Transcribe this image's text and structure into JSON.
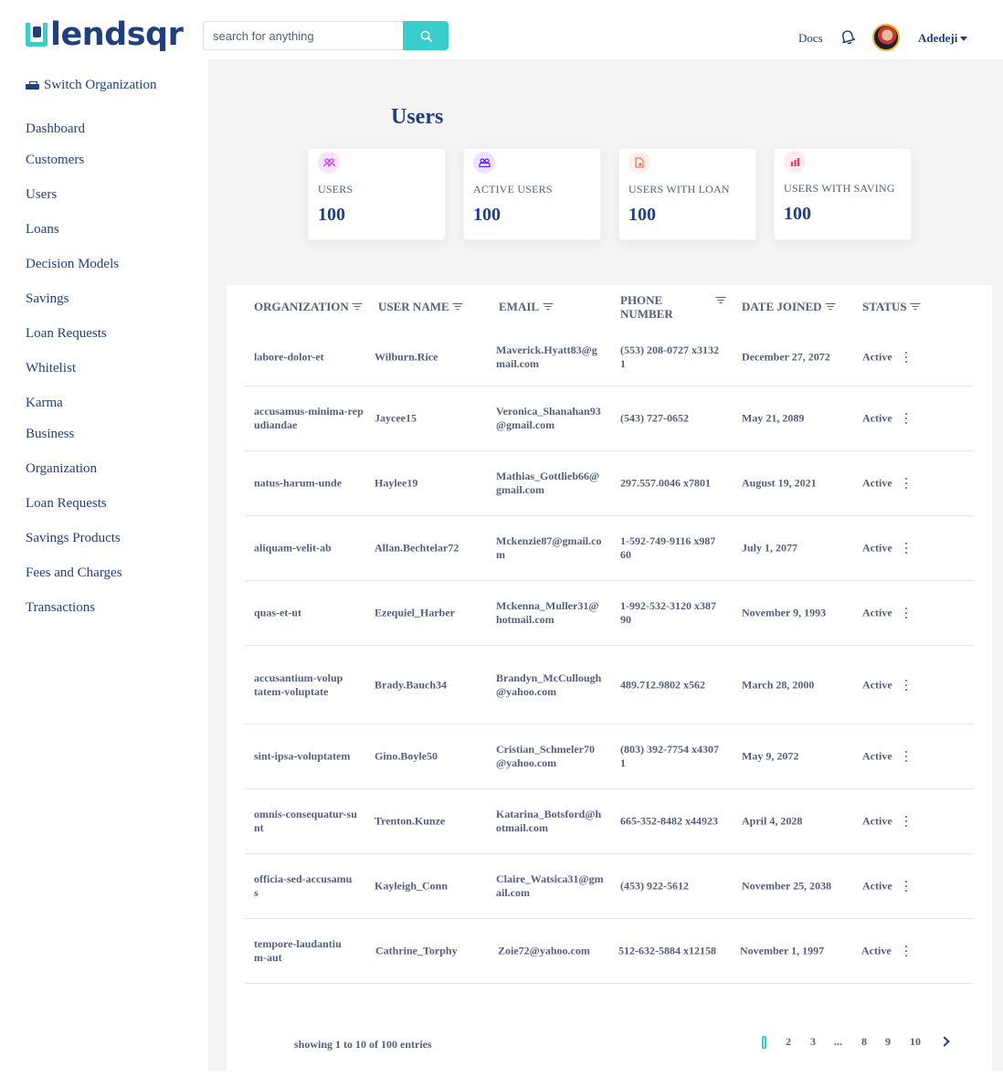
{
  "header": {
    "logo_text": "lendsqr",
    "search_placeholder": "search for anything",
    "docs_label": "Docs",
    "user_name": "Adedeji"
  },
  "sidebar": {
    "switch_org_label": "Switch Organization",
    "items": [
      {
        "label": "Dashboard"
      },
      {
        "label": "Customers"
      },
      {
        "label": "Users"
      },
      {
        "label": "Loans"
      },
      {
        "label": "Decision Models"
      },
      {
        "label": "Savings"
      },
      {
        "label": "Loan Requests"
      },
      {
        "label": "Whitelist"
      },
      {
        "label": "Karma"
      },
      {
        "label": "Business"
      },
      {
        "label": "Organization"
      },
      {
        "label": "Loan Requests"
      },
      {
        "label": "Savings Products"
      },
      {
        "label": "Fees and Charges"
      },
      {
        "label": "Transactions"
      }
    ]
  },
  "main": {
    "title": "Users",
    "cards": [
      {
        "label": "USERS",
        "value": "100",
        "icon": "users-icon",
        "color": "#df18ff"
      },
      {
        "label": "ACTIVE USERS",
        "value": "100",
        "icon": "active-users-icon",
        "color": "#5718ff"
      },
      {
        "label": "USERS WITH LOAN",
        "value": "100",
        "icon": "loan-icon",
        "color": "#f55f44"
      },
      {
        "label": "USERS WITH SAVING",
        "value": "100",
        "icon": "savings-icon",
        "color": "#ff3366"
      }
    ],
    "table": {
      "headers": [
        "ORGANIZATION",
        "USER NAME",
        "EMAIL",
        "PHONE NUMBER",
        "DATE JOINED",
        "STATUS"
      ],
      "rows": [
        {
          "org": "labore-dolor-et",
          "user": "Wilburn.Rice",
          "email": "Maverick.Hyatt83@gmail.com",
          "phone": "(553) 208-0727 x31321",
          "date": "December 27, 2072",
          "status": "Active"
        },
        {
          "org": "accusamus-minima-repudiandae",
          "user": "Jaycee15",
          "email": "Veronica_Shanahan93@gmail.com",
          "phone": "(543) 727-0652",
          "date": "May 21, 2089",
          "status": "Active"
        },
        {
          "org": "natus-harum-unde",
          "user": "Haylee19",
          "email": "Mathias_Gottlieb66@gmail.com",
          "phone": "297.557.0046 x7801",
          "date": "August 19, 2021",
          "status": "Active"
        },
        {
          "org": "aliquam-velit-ab",
          "user": "Allan.Bechtelar72",
          "email": "Mckenzie87@gmail.com",
          "phone": "1-592-749-9116 x98760",
          "date": "July 1, 2077",
          "status": "Active"
        },
        {
          "org": "quas-et-ut",
          "user": "Ezequiel_Harber",
          "email": "Mckenna_Muller31@hotmail.com",
          "phone": "1-992-532-3120 x38790",
          "date": "November 9, 1993",
          "status": "Active"
        },
        {
          "org": "accusantium-voluptatem-voluptate",
          "user": "Brady.Bauch34",
          "email": "Brandyn_McCullough@yahoo.com",
          "phone": "489.712.9802 x562",
          "date": "March 28, 2000",
          "status": "Active"
        },
        {
          "org": "sint-ipsa-voluptatem",
          "user": "Gino.Boyle50",
          "email": "Cristian_Schmeler70@yahoo.com",
          "phone": "(803) 392-7754 x43071",
          "date": "May 9, 2072",
          "status": "Active"
        },
        {
          "org": "omnis-consequatur-sunt",
          "user": "Trenton.Kunze",
          "email": "Katarina_Botsford@hotmail.com",
          "phone": "665-352-8482 x44923",
          "date": "April 4, 2028",
          "status": "Active"
        },
        {
          "org": "officia-sed-accusamus",
          "user": "Kayleigh_Conn",
          "email": "Claire_Watsica31@gmail.com",
          "phone": "(453) 922-5612",
          "date": "November 25, 2038",
          "status": "Active"
        },
        {
          "org": "tempore-laudantium-aut",
          "user": "Cathrine_Torphy",
          "email": "Zoie72@yahoo.com",
          "phone": "512-632-5884 x12158",
          "date": "November 1, 1997",
          "status": "Active"
        }
      ]
    },
    "pagination": {
      "showing_text": "showing 1 to 10 of 100 entries",
      "pages": [
        "2",
        "3",
        "...",
        "8",
        "9",
        "10"
      ]
    }
  },
  "colors": {
    "brand_navy": "#213f7d",
    "accent_teal": "#39cdcc",
    "text_gray": "#545f7d",
    "background": "#f4f4f4"
  }
}
